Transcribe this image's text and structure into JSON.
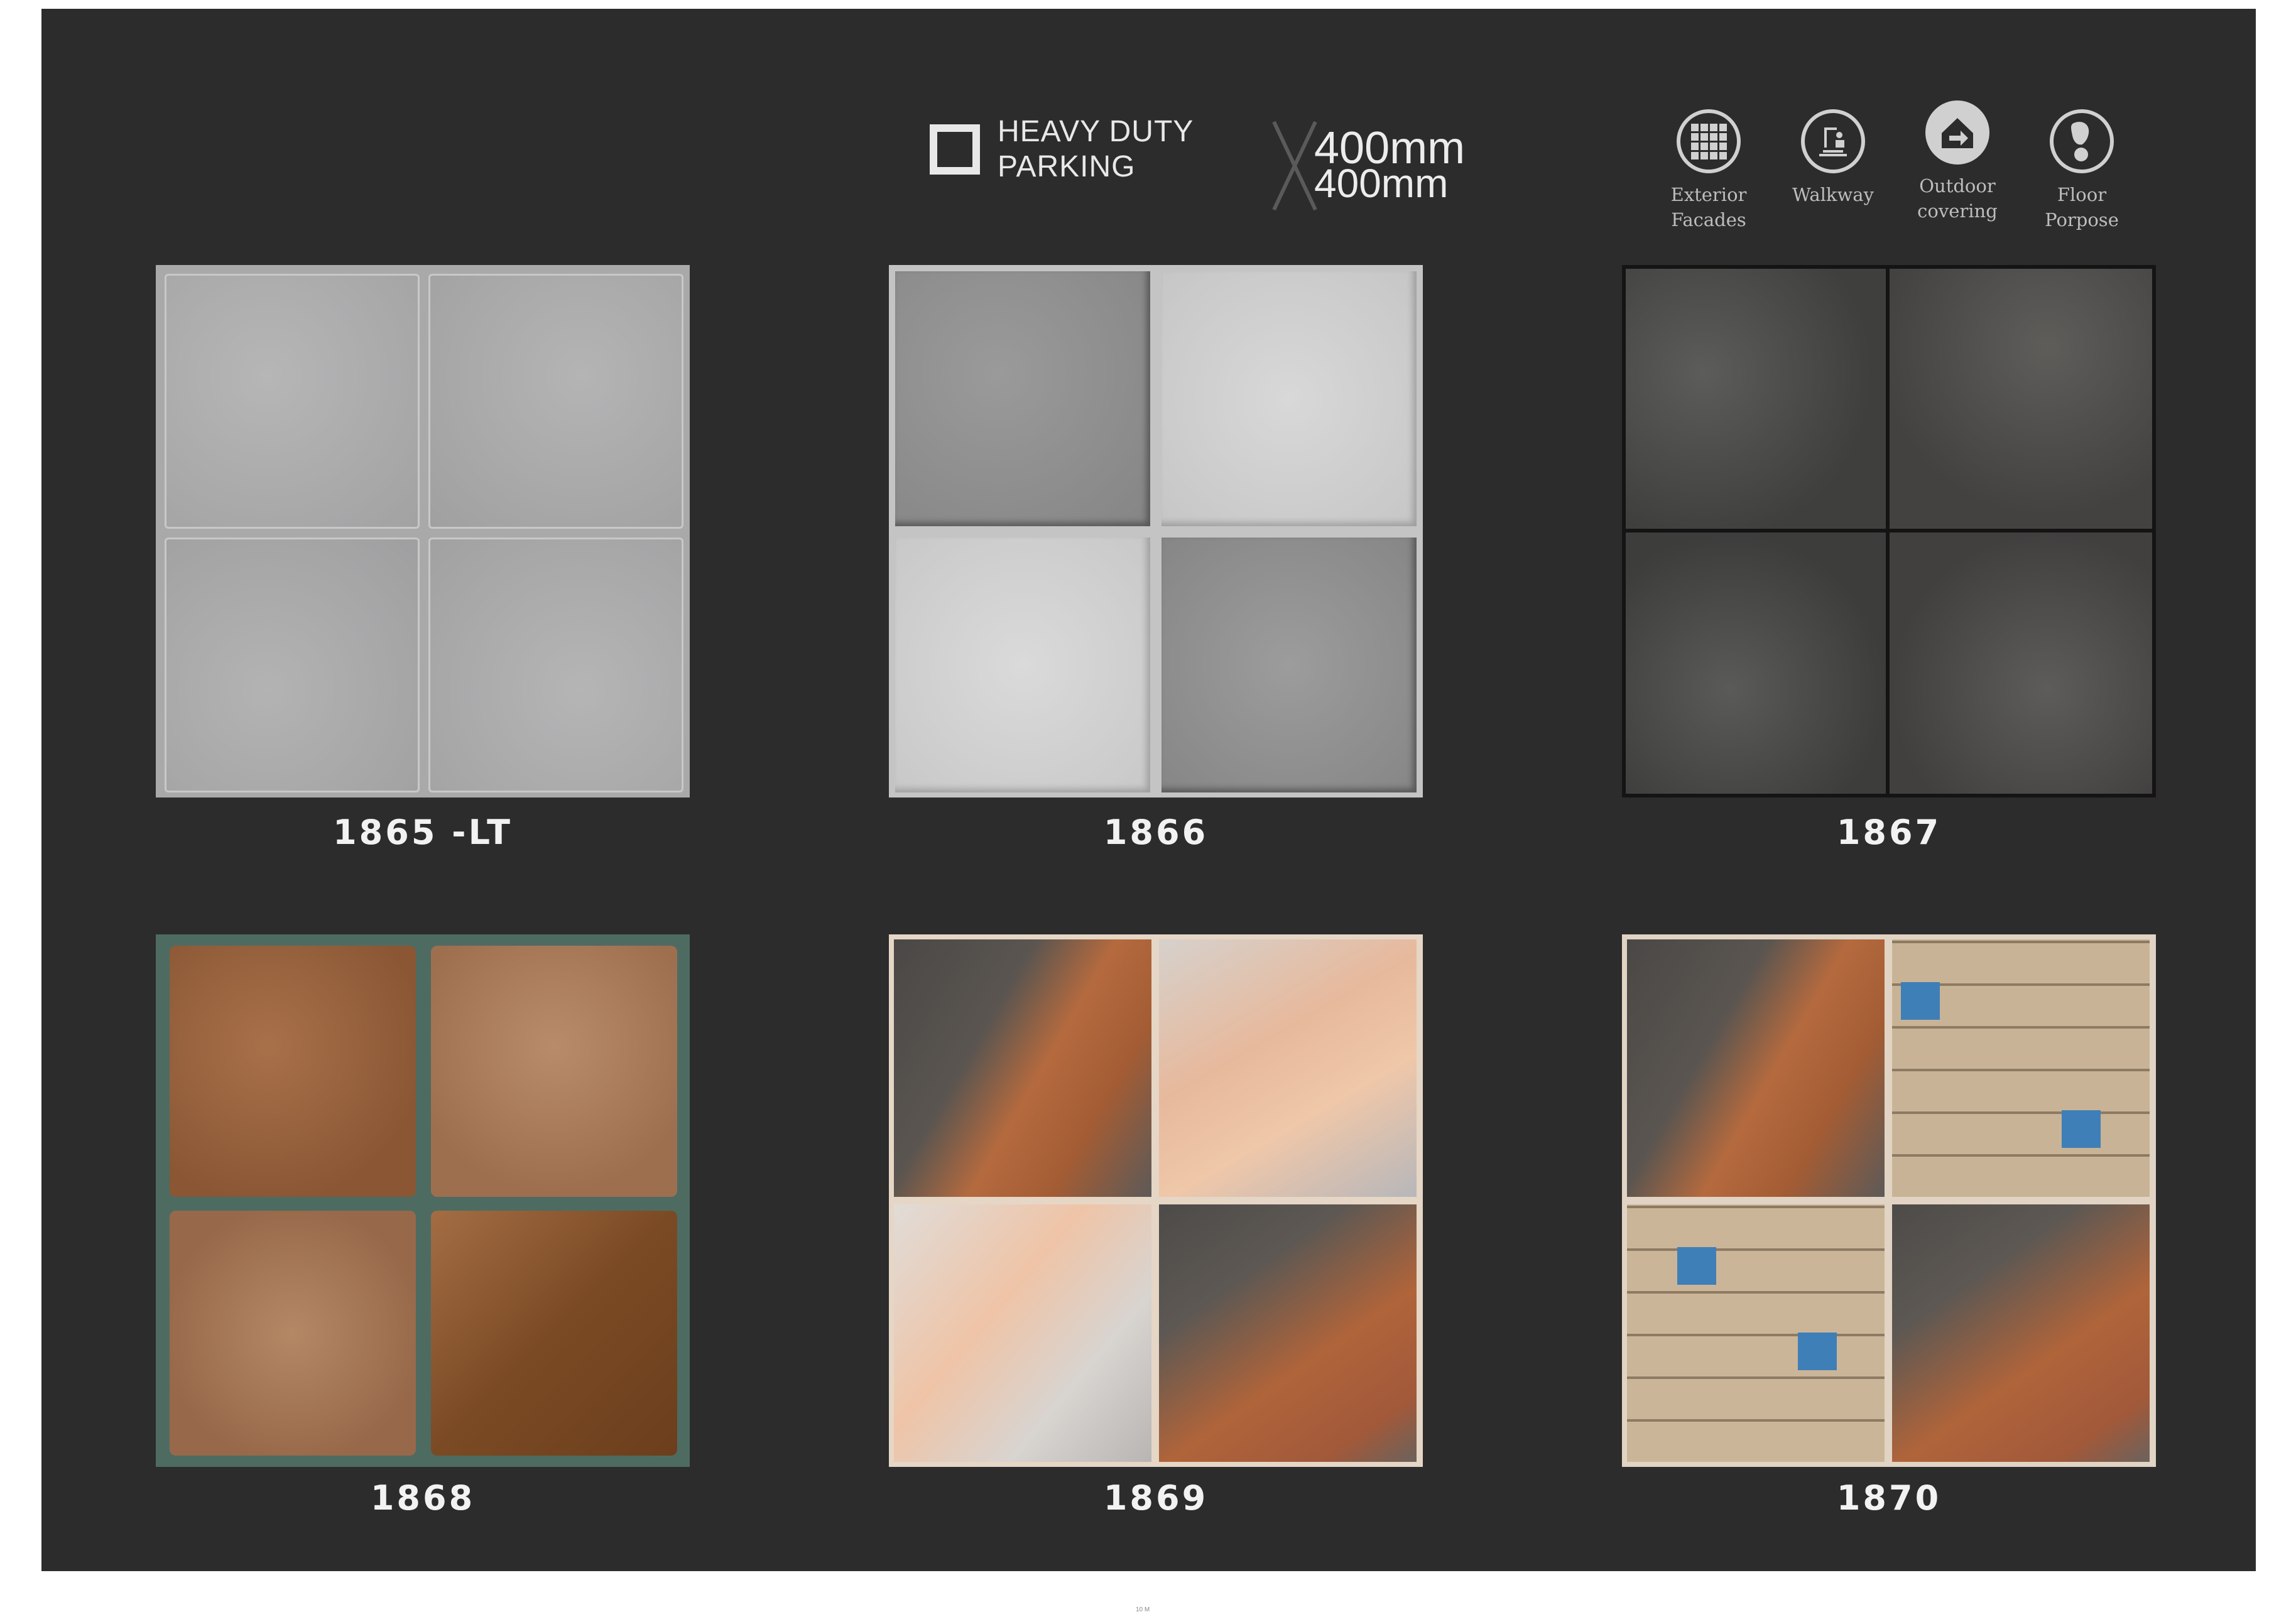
{
  "header": {
    "badge_line1": "HEAVY DUTY",
    "badge_line2": "PARKING",
    "size_top": "400mm",
    "size_bottom": "400mm",
    "size_separator_glyph": "X"
  },
  "usage_icons": [
    {
      "icon": "grid-icon",
      "line1": "Exterior",
      "line2": "Facades"
    },
    {
      "icon": "walkway-icon",
      "line1": "Walkway",
      "line2": ""
    },
    {
      "icon": "house-arrow-icon",
      "line1": "Outdoor",
      "line2": "covering"
    },
    {
      "icon": "footprint-icon",
      "line1": "Floor",
      "line2": "Porpose"
    }
  ],
  "tiles": [
    {
      "code": "1865 -LT",
      "style": "light-grey-stone"
    },
    {
      "code": "1866",
      "style": "grey-checker"
    },
    {
      "code": "1867",
      "style": "dark-granite"
    },
    {
      "code": "1868",
      "style": "rust-with-grass"
    },
    {
      "code": "1869",
      "style": "multicolor-slate"
    },
    {
      "code": "1870",
      "style": "slate-and-mosaic"
    }
  ],
  "colors": {
    "background": "#2c2c2c",
    "text": "#f2f2f2",
    "icon_label": "#bdbdbd"
  },
  "footer": {
    "page_mark": "10 M"
  }
}
